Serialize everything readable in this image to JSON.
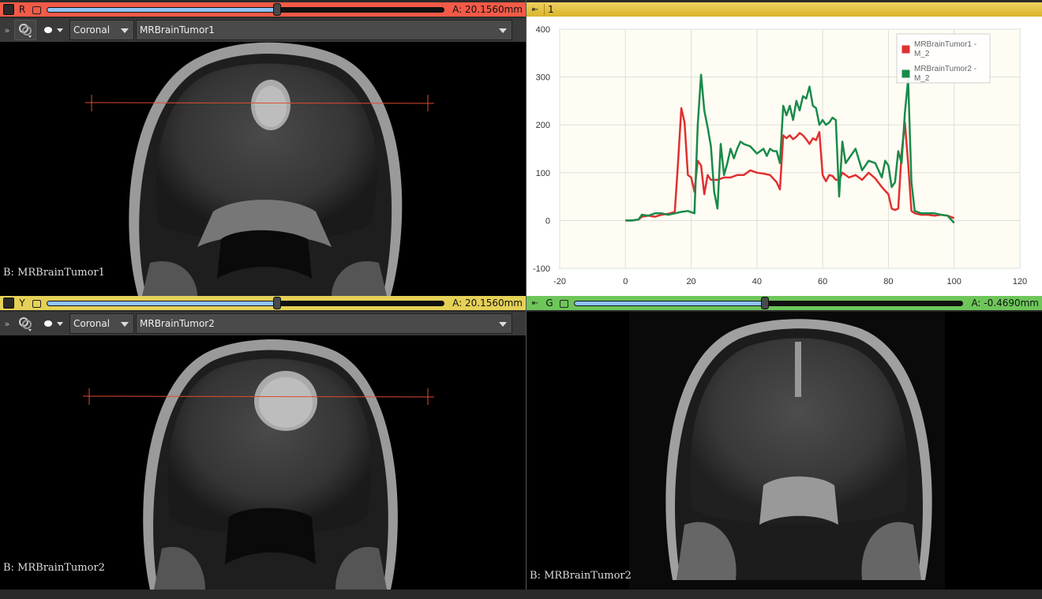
{
  "views": {
    "red": {
      "letter": "R",
      "offset": "A: 20.1560mm",
      "orientation": "Coronal",
      "volume": "MRBrainTumor1",
      "label": "B: MRBrainTumor1",
      "color": "#f35a47",
      "slider_fraction": 0.58
    },
    "yellow": {
      "letter": "Y",
      "offset": "A: 20.1560mm",
      "orientation": "Coronal",
      "volume": "MRBrainTumor2",
      "label": "B: MRBrainTumor2",
      "color": "#e5d156",
      "slider_fraction": 0.58
    },
    "green": {
      "letter": "G",
      "offset": "A: -0.4690mm",
      "label": "B: MRBrainTumor2",
      "color": "#6ec65a",
      "slider_fraction": 0.49
    }
  },
  "chart_view": {
    "id": "1"
  },
  "chart_data": {
    "type": "line",
    "xlim": [
      -20,
      120
    ],
    "ylim": [
      -100,
      400
    ],
    "xticks": [
      -20,
      0,
      20,
      40,
      60,
      80,
      100,
      120
    ],
    "yticks": [
      -100,
      0,
      100,
      200,
      300,
      400
    ],
    "grid": true,
    "legend_position": "top-right",
    "series": [
      {
        "name": "MRBrainTumor1 - M_2",
        "color": "#e03030",
        "x": [
          0,
          2,
          4,
          5,
          7,
          9,
          11,
          13,
          15,
          16,
          17,
          18,
          19,
          20,
          21,
          22,
          23,
          24,
          25,
          26,
          28,
          30,
          32,
          34,
          36,
          38,
          40,
          42,
          44,
          46,
          47,
          48,
          49,
          50,
          51,
          52,
          53,
          54,
          55,
          56,
          57,
          58,
          59,
          60,
          61,
          62,
          63,
          64,
          65,
          66,
          68,
          70,
          72,
          74,
          76,
          78,
          80,
          81,
          82,
          83,
          84,
          85,
          86,
          87,
          88,
          90,
          92,
          94,
          96,
          98,
          100
        ],
        "y": [
          0,
          0,
          2,
          8,
          10,
          8,
          12,
          14,
          18,
          120,
          235,
          205,
          95,
          90,
          60,
          125,
          115,
          55,
          95,
          85,
          85,
          90,
          90,
          95,
          95,
          105,
          100,
          98,
          95,
          80,
          65,
          178,
          172,
          178,
          170,
          175,
          183,
          178,
          170,
          160,
          172,
          168,
          185,
          95,
          82,
          95,
          93,
          85,
          85,
          100,
          90,
          95,
          85,
          100,
          88,
          70,
          55,
          25,
          22,
          25,
          140,
          205,
          120,
          20,
          15,
          12,
          12,
          10,
          12,
          10,
          5
        ]
      },
      {
        "name": "MRBrainTumor2 - M_2",
        "color": "#1a8a4a",
        "x": [
          0,
          2,
          4,
          5,
          7,
          9,
          11,
          13,
          15,
          17,
          19,
          21,
          22,
          23,
          24,
          25,
          26,
          27,
          28,
          29,
          30,
          31,
          32,
          33,
          34,
          35,
          36,
          38,
          40,
          42,
          43,
          44,
          45,
          46,
          47,
          48,
          49,
          50,
          51,
          52,
          53,
          54,
          55,
          56,
          57,
          58,
          59,
          60,
          61,
          62,
          63,
          64,
          65,
          66,
          67,
          68,
          70,
          72,
          74,
          76,
          78,
          79,
          80,
          81,
          82,
          83,
          84,
          85,
          86,
          87,
          88,
          90,
          92,
          94,
          96,
          98,
          100
        ],
        "y": [
          0,
          0,
          2,
          12,
          10,
          15,
          15,
          12,
          15,
          18,
          20,
          15,
          200,
          305,
          230,
          195,
          155,
          60,
          25,
          160,
          95,
          120,
          150,
          130,
          150,
          165,
          160,
          155,
          140,
          150,
          135,
          150,
          145,
          145,
          120,
          240,
          220,
          240,
          210,
          250,
          230,
          260,
          255,
          280,
          240,
          235,
          200,
          210,
          200,
          205,
          215,
          210,
          50,
          165,
          120,
          130,
          150,
          105,
          125,
          120,
          90,
          125,
          115,
          70,
          80,
          145,
          120,
          225,
          295,
          80,
          20,
          15,
          15,
          15,
          12,
          10,
          -5
        ]
      }
    ]
  }
}
